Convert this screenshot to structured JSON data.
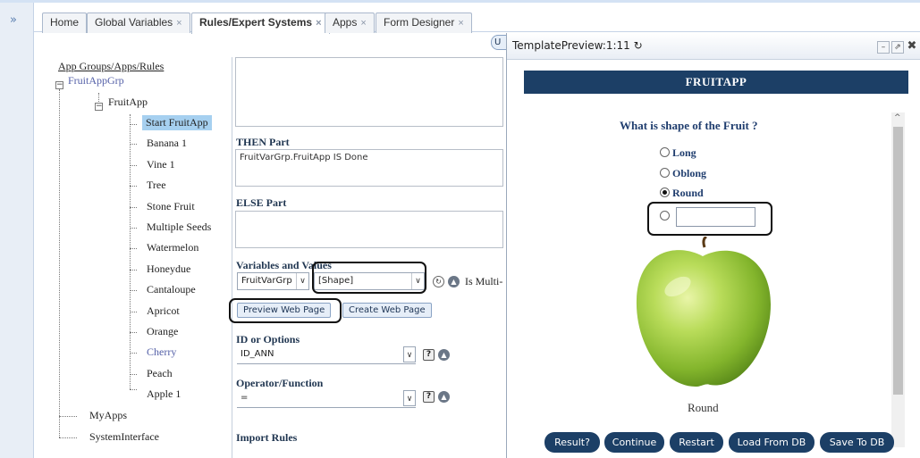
{
  "tabs": [
    {
      "label": "Home",
      "closable": false
    },
    {
      "label": "Global Variables",
      "closable": true
    },
    {
      "label": "Rules/Expert Systems",
      "closable": true
    },
    {
      "label": "Apps",
      "closable": true
    },
    {
      "label": "Form Designer",
      "closable": true
    }
  ],
  "close_glyph": "×",
  "expander_glyph": "»",
  "tree": {
    "root": "App Groups/Apps/Rules",
    "group": "FruitAppGrp",
    "app": "FruitApp",
    "rules": [
      "Start FruitApp",
      "Banana 1",
      "Vine 1",
      "Tree",
      "Stone Fruit",
      "Multiple Seeds",
      "Watermelon",
      "Honeydue",
      "Cantaloupe",
      "Apricot",
      "Orange",
      "Cherry",
      "Peach",
      "Apple 1"
    ],
    "others": [
      "MyApps",
      "SystemInterface"
    ]
  },
  "editor": {
    "then_label": "THEN Part",
    "then_value": "FruitVarGrp.FruitApp IS Done",
    "else_label": "ELSE Part",
    "vars_label": "Variables and Values",
    "var_group": "FruitVarGrp",
    "var_value": "[Shape]",
    "multi_label": "Is Multi-",
    "preview_button": "Preview Web Page",
    "create_button": "Create Web Page",
    "id_label": "ID or Options",
    "id_value": "ID_ANN",
    "operator_label": "Operator/Function",
    "operator_value": "=",
    "import_label": "Import Rules",
    "hidden_button_fragment": "U"
  },
  "preview": {
    "title": "TemplatePreview:1:11",
    "banner": "FRUITAPP",
    "question": "What is shape of the Fruit ?",
    "options": [
      {
        "label": "Long",
        "selected": false
      },
      {
        "label": "Oblong",
        "selected": false
      },
      {
        "label": "Round",
        "selected": true
      }
    ],
    "other_value": "",
    "caption": "Round",
    "image": "green-apple",
    "buttons": [
      "Result?",
      "Continue",
      "Restart",
      "Load From DB",
      "Save To DB"
    ]
  },
  "colors": {
    "banner": "#1c3f66",
    "selected_node": "#a6d0f0",
    "question": "#1f3d6e"
  }
}
